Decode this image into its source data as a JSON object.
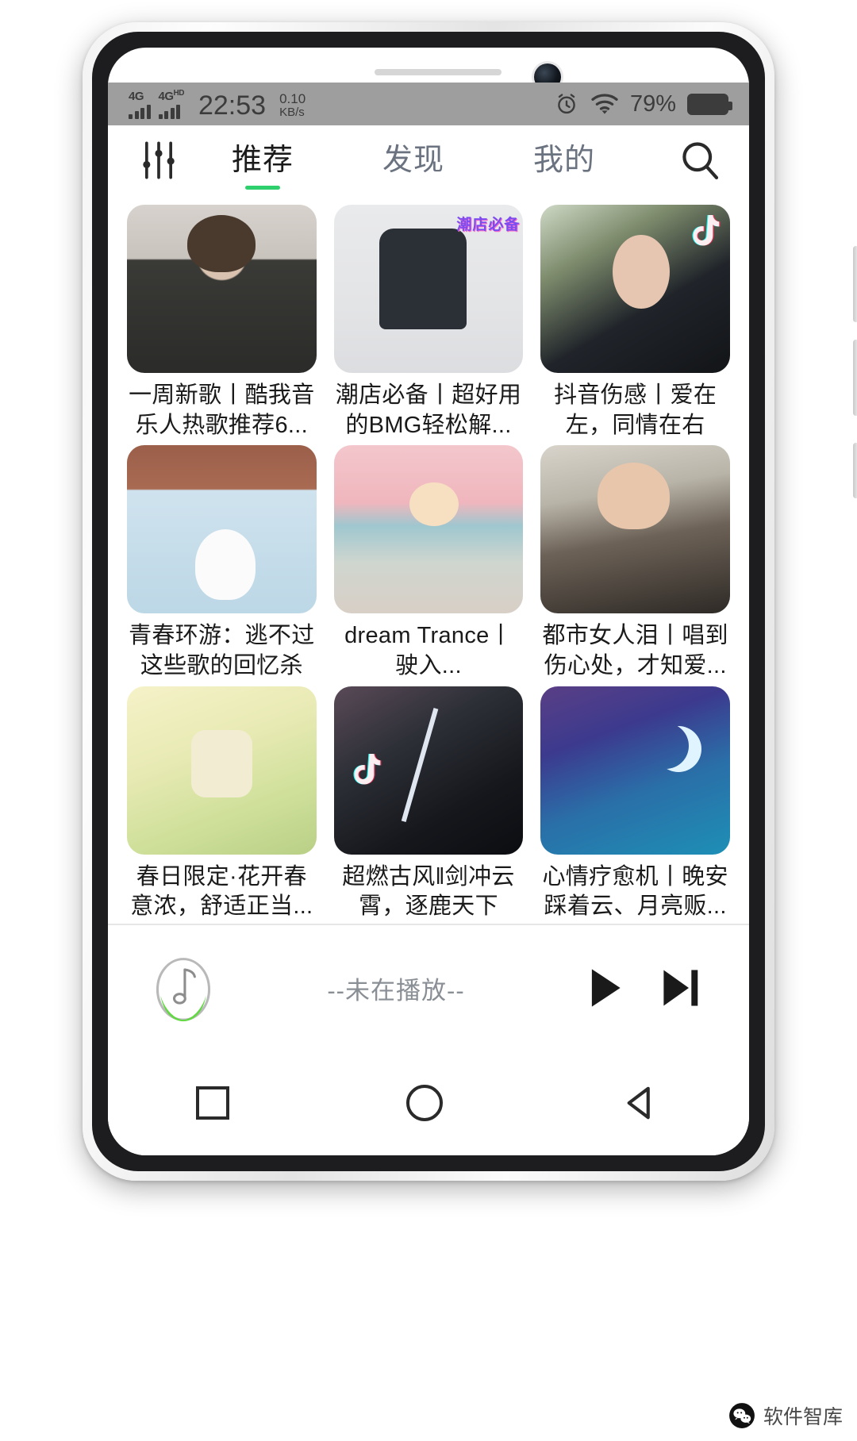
{
  "status_bar": {
    "network_1": "4G",
    "network_2": "4G",
    "network_2_sup": "HD",
    "time": "22:53",
    "net_speed_value": "0.10",
    "net_speed_unit": "KB/s",
    "alarm_icon": "alarm-clock-icon",
    "wifi_icon": "wifi-icon",
    "battery_percent": "79%"
  },
  "header": {
    "equalizer_icon": "equalizer-sliders-icon",
    "search_icon": "search-icon",
    "tabs": [
      {
        "label": "推荐",
        "active": true
      },
      {
        "label": "发现",
        "active": false
      },
      {
        "label": "我的",
        "active": false
      }
    ],
    "active_indicator_color": "#2ed06e",
    "active_color": "#1a1a1a",
    "inactive_color": "#6b7280"
  },
  "grid": {
    "cards": [
      {
        "title": "一周新歌丨酷我音乐人热歌推荐6...",
        "badge": null
      },
      {
        "title": "潮店必备丨超好用的BMG轻松解...",
        "badge": null,
        "overlay_text": "潮店必备"
      },
      {
        "title": "抖音伤感丨爱在左，同情在右",
        "badge": "tiktok-icon"
      },
      {
        "title": "青春环游：逃不过这些歌的回忆杀",
        "badge": null
      },
      {
        "title": "dream Trance丨驶入...",
        "badge": null
      },
      {
        "title": "都市女人泪丨唱到伤心处，才知爱...",
        "badge": null
      },
      {
        "title": "春日限定·花开春意浓，舒适正当...",
        "badge": null
      },
      {
        "title": "超燃古风‖剑冲云霄，逐鹿天下",
        "badge": "tiktok-icon"
      },
      {
        "title": "心情疗愈机丨晚安踩着云、月亮贩...",
        "badge": null
      },
      {
        "title": "",
        "badge": null
      },
      {
        "title": "",
        "badge": null
      },
      {
        "title": "",
        "badge": null
      }
    ]
  },
  "player": {
    "album_icon": "music-note-disc-icon",
    "now_playing_text": "--未在播放--",
    "play_button": "play-icon",
    "next_button": "next-track-icon"
  },
  "nav_bar": {
    "recents": "square-recents-icon",
    "home": "circle-home-icon",
    "back": "triangle-back-icon"
  },
  "watermark": {
    "logo": "wechat-logo-icon",
    "text": "软件智库"
  }
}
